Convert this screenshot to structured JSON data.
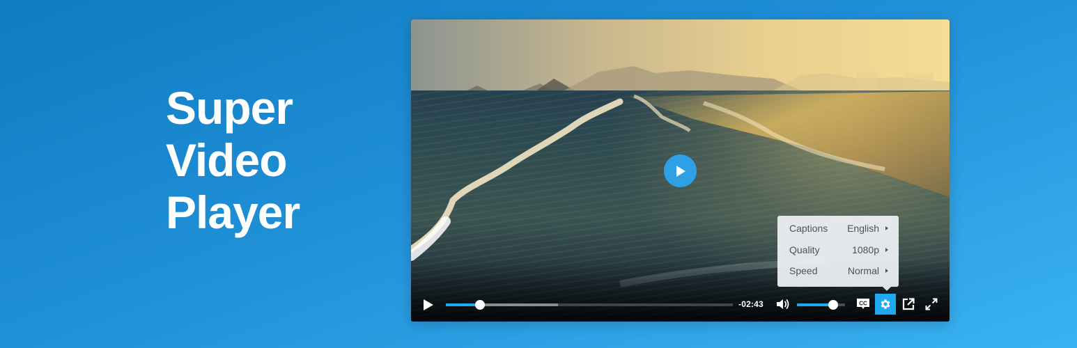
{
  "headline": {
    "lines": [
      "Super",
      "Video",
      "Player"
    ]
  },
  "player": {
    "center_play_icon": "play-icon",
    "settings_menu": {
      "items": [
        {
          "label": "Captions",
          "value": "English"
        },
        {
          "label": "Quality",
          "value": "1080p"
        },
        {
          "label": "Speed",
          "value": "Normal"
        }
      ]
    },
    "controls": {
      "play_icon": "play-icon",
      "progress": {
        "played_percent": 12,
        "buffered_percent": 39
      },
      "time_remaining": "-02:43",
      "volume_icon": "volume-icon",
      "volume_percent": 75,
      "buttons": [
        {
          "name": "captions",
          "icon": "cc-icon",
          "active": false
        },
        {
          "name": "settings",
          "icon": "gear-icon",
          "active": true
        },
        {
          "name": "popout",
          "icon": "external-link-icon",
          "active": false
        },
        {
          "name": "fullscreen",
          "icon": "expand-icon",
          "active": false
        }
      ]
    }
  },
  "colors": {
    "accent": "#1eaaf1",
    "background_start": "#0f7bc0",
    "background_end": "#3ab2f3",
    "menu_text": "#4a5258"
  }
}
